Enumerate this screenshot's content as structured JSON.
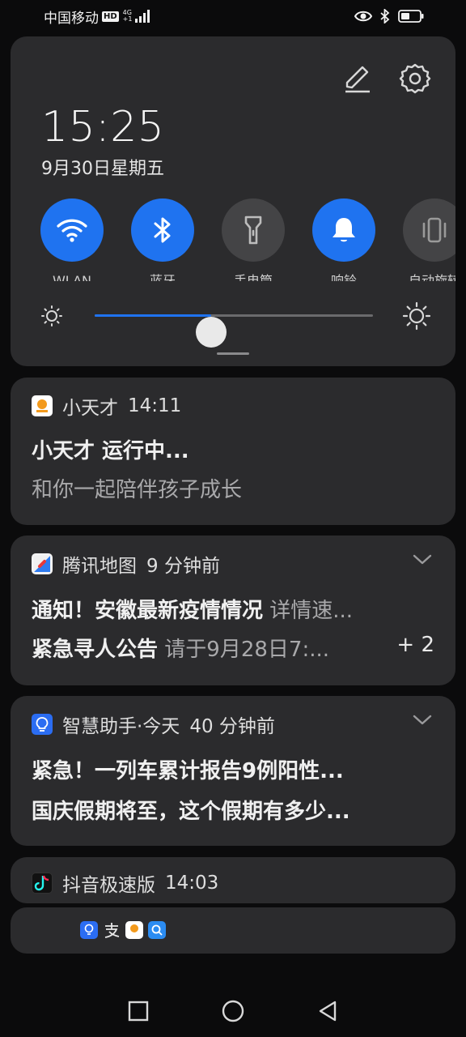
{
  "status_bar": {
    "carrier": "中国移动",
    "hd": "HD",
    "net_top": "4G",
    "net_bottom": "+1"
  },
  "quick_settings": {
    "time": "15:25",
    "date": "9月30日星期五",
    "toggles": [
      {
        "label": "WLAN",
        "icon": "wifi-icon",
        "on": true
      },
      {
        "label": "蓝牙",
        "icon": "bluetooth-icon",
        "on": true
      },
      {
        "label": "手电筒",
        "icon": "flashlight-icon",
        "on": false
      },
      {
        "label": "响铃",
        "icon": "bell-icon",
        "on": true
      },
      {
        "label": "自动旋转",
        "icon": "vibrate-icon",
        "on": false
      }
    ],
    "brightness_level": 0.42,
    "accent_color": "#1f73f0"
  },
  "notifications": [
    {
      "app": "小天才",
      "time": "14:11",
      "title": "小天才 运行中...",
      "body": "和你一起陪伴孩子成长"
    },
    {
      "app": "腾讯地图",
      "time": "9 分钟前",
      "line1_title": "通知！安徽最新疫情情况",
      "line1_sub": "详情速...",
      "line2_title": "紧急寻人公告",
      "line2_sub": "请于9月28日7:...",
      "more": "+ 2"
    },
    {
      "app": "智慧助手·今天",
      "time": "40 分钟前",
      "line1_title": "紧急！一列车累计报告9例阳性...",
      "line2_title": "国庆假期将至，这个假期有多少..."
    },
    {
      "app": "抖音极速版",
      "time": "14:03"
    }
  ],
  "collapsed_icons": [
    "assistant-icon",
    "alipay-icon",
    "xiaotiancai-icon",
    "search-icon"
  ]
}
